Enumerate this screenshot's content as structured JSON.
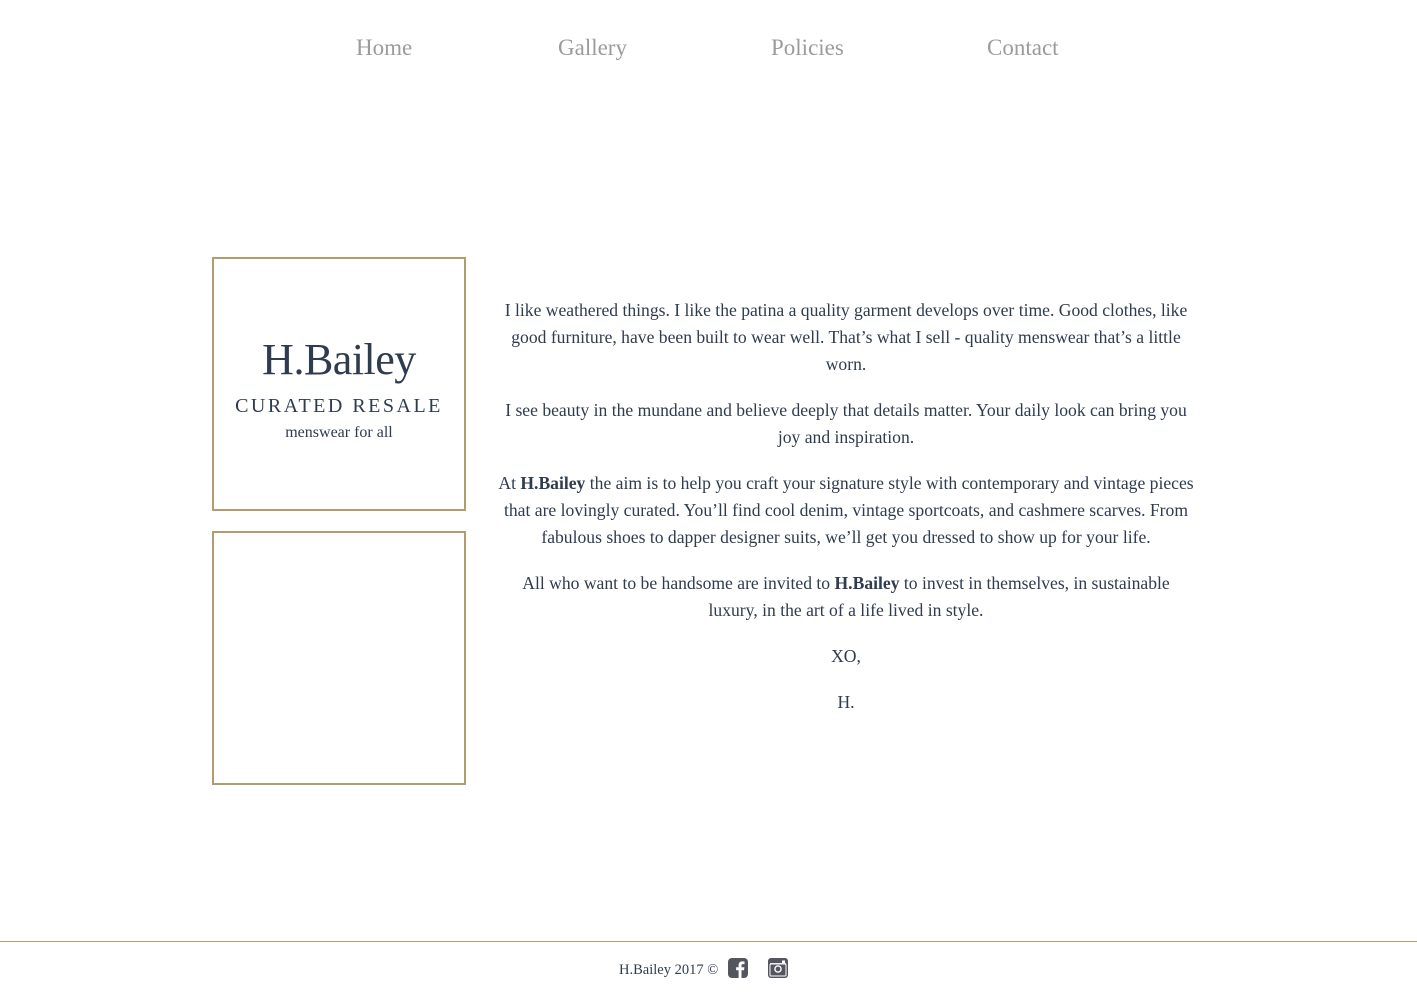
{
  "nav": {
    "items": [
      {
        "label": "Home"
      },
      {
        "label": "Gallery"
      },
      {
        "label": "Policies"
      },
      {
        "label": "Contact"
      }
    ]
  },
  "logo": {
    "title": "H.Bailey",
    "subtitle": "CURATED RESALE",
    "tagline": "menswear for all"
  },
  "content": {
    "p1": "I like weathered things. I like the patina a quality garment develops over time. Good clothes, like good furniture, have been built to wear well. That’s what I sell - quality menswear that’s a little worn.",
    "p2": "I see beauty in the mundane and believe deeply that details matter. Your daily look can bring you joy and inspiration.",
    "p3_before": "At ",
    "p3_brand": "H.Bailey",
    "p3_after": " the aim is to help you craft your signature style with contemporary and vintage pieces that are lovingly curated. You’ll find cool denim, vintage sportcoats, and cashmere scarves. From fabulous shoes to dapper designer suits, we’ll get you dressed to show up for your life.",
    "p4_before": "All who want to be handsome are invited to ",
    "p4_brand": "H.Bailey",
    "p4_after": " to invest in themselves, in sustainable luxury, in the art of a life lived in style.",
    "signoff": "XO,",
    "signature": "H."
  },
  "footer": {
    "copyright": "H.Bailey 2017 ©",
    "icons": [
      "facebook-icon",
      "instagram-icon"
    ]
  },
  "colors": {
    "accent": "#b39b6f",
    "text": "#2f3b4f",
    "nav": "#9b9b9b"
  }
}
